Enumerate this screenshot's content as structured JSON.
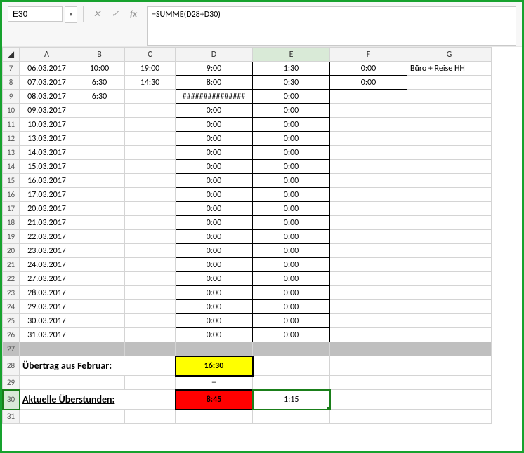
{
  "namebox": "E30",
  "formula": "=SUMME(D28+D30)",
  "columns": [
    "A",
    "B",
    "C",
    "D",
    "E",
    "F",
    "G"
  ],
  "rows": [
    {
      "n": 7,
      "A": "06.03.2017",
      "B": "10:00",
      "C": "19:00",
      "D": "9:00",
      "E": "1:30",
      "F": "0:00",
      "G": "Büro + Reise HH"
    },
    {
      "n": 8,
      "A": "07.03.2017",
      "B": "6:30",
      "C": "14:30",
      "D": "8:00",
      "E": "0:30",
      "F": "0:00",
      "G": ""
    },
    {
      "n": 9,
      "A": "08.03.2017",
      "B": "6:30",
      "C": "",
      "D": "###############",
      "E": "0:00",
      "F": "",
      "G": ""
    },
    {
      "n": 10,
      "A": "09.03.2017",
      "B": "",
      "C": "",
      "D": "0:00",
      "E": "0:00",
      "F": "",
      "G": ""
    },
    {
      "n": 11,
      "A": "10.03.2017",
      "B": "",
      "C": "",
      "D": "0:00",
      "E": "0:00",
      "F": "",
      "G": ""
    },
    {
      "n": 12,
      "A": "13.03.2017",
      "B": "",
      "C": "",
      "D": "0:00",
      "E": "0:00",
      "F": "",
      "G": ""
    },
    {
      "n": 13,
      "A": "14.03.2017",
      "B": "",
      "C": "",
      "D": "0:00",
      "E": "0:00",
      "F": "",
      "G": ""
    },
    {
      "n": 14,
      "A": "15.03.2017",
      "B": "",
      "C": "",
      "D": "0:00",
      "E": "0:00",
      "F": "",
      "G": ""
    },
    {
      "n": 15,
      "A": "16.03.2017",
      "B": "",
      "C": "",
      "D": "0:00",
      "E": "0:00",
      "F": "",
      "G": ""
    },
    {
      "n": 16,
      "A": "17.03.2017",
      "B": "",
      "C": "",
      "D": "0:00",
      "E": "0:00",
      "F": "",
      "G": ""
    },
    {
      "n": 17,
      "A": "20.03.2017",
      "B": "",
      "C": "",
      "D": "0:00",
      "E": "0:00",
      "F": "",
      "G": ""
    },
    {
      "n": 18,
      "A": "21.03.2017",
      "B": "",
      "C": "",
      "D": "0:00",
      "E": "0:00",
      "F": "",
      "G": ""
    },
    {
      "n": 19,
      "A": "22.03.2017",
      "B": "",
      "C": "",
      "D": "0:00",
      "E": "0:00",
      "F": "",
      "G": ""
    },
    {
      "n": 20,
      "A": "23.03.2017",
      "B": "",
      "C": "",
      "D": "0:00",
      "E": "0:00",
      "F": "",
      "G": ""
    },
    {
      "n": 21,
      "A": "24.03.2017",
      "B": "",
      "C": "",
      "D": "0:00",
      "E": "0:00",
      "F": "",
      "G": ""
    },
    {
      "n": 22,
      "A": "27.03.2017",
      "B": "",
      "C": "",
      "D": "0:00",
      "E": "0:00",
      "F": "",
      "G": ""
    },
    {
      "n": 23,
      "A": "28.03.2017",
      "B": "",
      "C": "",
      "D": "0:00",
      "E": "0:00",
      "F": "",
      "G": ""
    },
    {
      "n": 24,
      "A": "29.03.2017",
      "B": "",
      "C": "",
      "D": "0:00",
      "E": "0:00",
      "F": "",
      "G": ""
    },
    {
      "n": 25,
      "A": "30.03.2017",
      "B": "",
      "C": "",
      "D": "0:00",
      "E": "0:00",
      "F": "",
      "G": ""
    },
    {
      "n": 26,
      "A": "31.03.2017",
      "B": "",
      "C": "",
      "D": "0:00",
      "E": "0:00",
      "F": "",
      "G": ""
    }
  ],
  "row27": 27,
  "row28": {
    "n": 28,
    "label": "Übertrag aus Februar:",
    "D": "16:30"
  },
  "row29": {
    "n": 29,
    "D": "+"
  },
  "row30": {
    "n": 30,
    "label": "Aktuelle Überstunden:",
    "D": "8:45",
    "E": "1:15"
  },
  "row31": 31
}
